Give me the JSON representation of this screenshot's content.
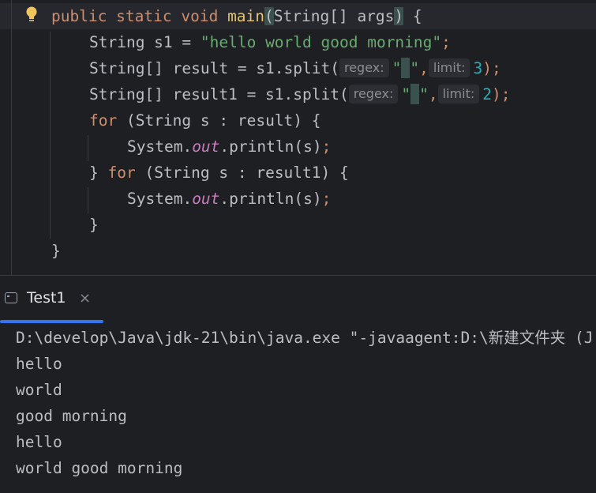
{
  "editor": {
    "lines": [
      {
        "parts": [
          {
            "t": "public static void ",
            "c": "kw"
          },
          {
            "t": "main",
            "c": "fnm"
          },
          {
            "t": "(",
            "c": "paren-hl"
          },
          {
            "t": "String[] args",
            "c": "punc"
          },
          {
            "t": ")",
            "c": "paren-hl"
          },
          {
            "t": " {",
            "c": "punc"
          }
        ]
      },
      {
        "parts": [
          {
            "t": "String s1 = ",
            "c": "punc"
          },
          {
            "t": "\"hello world good morning\"",
            "c": "str"
          },
          {
            "t": ";",
            "c": "semi"
          }
        ]
      },
      {
        "parts": [
          {
            "t": "String[] result = s1.split(",
            "c": "punc"
          },
          {
            "t": "regex:",
            "c": "hint"
          },
          {
            "t": "\"",
            "c": "str"
          },
          {
            "t": " ",
            "c": "space"
          },
          {
            "t": "\"",
            "c": "str"
          },
          {
            "t": ",",
            "c": "semi"
          },
          {
            "t": "limit:",
            "c": "hint"
          },
          {
            "t": "3",
            "c": "num"
          },
          {
            "t": ");",
            "c": "semi"
          }
        ]
      },
      {
        "parts": [
          {
            "t": "String[] result1 = s1.split(",
            "c": "punc"
          },
          {
            "t": "regex:",
            "c": "hint"
          },
          {
            "t": "\"",
            "c": "str"
          },
          {
            "t": " ",
            "c": "space"
          },
          {
            "t": "\"",
            "c": "str"
          },
          {
            "t": ",",
            "c": "semi"
          },
          {
            "t": "limit:",
            "c": "hint"
          },
          {
            "t": "2",
            "c": "num"
          },
          {
            "t": ");",
            "c": "semi"
          }
        ]
      },
      {
        "parts": [
          {
            "t": "for",
            "c": "kw"
          },
          {
            "t": " (String s : result) {",
            "c": "punc"
          }
        ]
      },
      {
        "parts": [
          {
            "t": "System.",
            "c": "punc"
          },
          {
            "t": "out",
            "c": "field"
          },
          {
            "t": ".println(s)",
            "c": "punc"
          },
          {
            "t": ";",
            "c": "semi"
          }
        ]
      },
      {
        "parts": [
          {
            "t": "} ",
            "c": "punc"
          },
          {
            "t": "for",
            "c": "kw"
          },
          {
            "t": " (String s : result1) {",
            "c": "punc"
          }
        ]
      },
      {
        "parts": [
          {
            "t": "System.",
            "c": "punc"
          },
          {
            "t": "out",
            "c": "field"
          },
          {
            "t": ".println(s)",
            "c": "punc"
          },
          {
            "t": ";",
            "c": "semi"
          }
        ]
      },
      {
        "parts": [
          {
            "t": "}",
            "c": "punc"
          }
        ]
      },
      {
        "parts": [
          {
            "t": "}",
            "c": "punc"
          }
        ]
      }
    ],
    "bulb_icon": "lightbulb-icon"
  },
  "run_panel": {
    "tab_label": "Test1",
    "tab_close": "×",
    "tab_icon": "console-icon"
  },
  "console": {
    "lines": [
      "D:\\develop\\Java\\jdk-21\\bin\\java.exe \"-javaagent:D:\\新建文件夹 (J",
      "hello",
      "world",
      "good morning",
      "hello",
      "world good morning"
    ]
  },
  "colors": {
    "background": "#1e1f22",
    "keyword": "#cf8e6d",
    "string": "#6aab73",
    "number": "#2aacb8",
    "field": "#c77dbb",
    "accent": "#3574f0"
  }
}
